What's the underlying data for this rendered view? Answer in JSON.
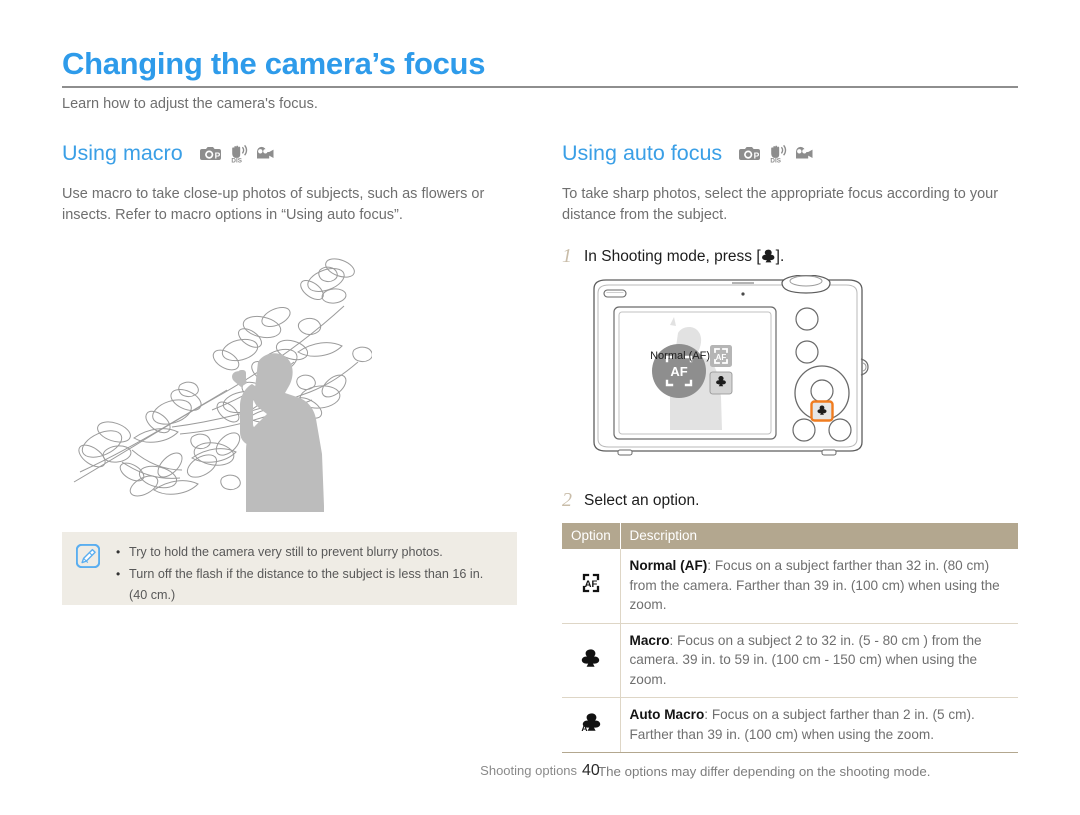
{
  "header": {
    "title": "Changing the camera’s focus",
    "subtitle": "Learn how to adjust the camera's focus.",
    "accent_color": "#2e9bea",
    "rule_color": "#8e8e8e"
  },
  "left_section": {
    "heading": "Using macro",
    "mode_icons": [
      "program-camera-icon",
      "dis-hand-icon",
      "movie-camera-icon"
    ],
    "body": "Use macro to take close-up photos of subjects, such as flowers or insects. Refer to macro options in “Using auto focus”.",
    "illustration": "magnolia-branch-photographer-illustration"
  },
  "right_section": {
    "heading": "Using auto focus",
    "mode_icons": [
      "program-camera-icon",
      "dis-hand-icon",
      "movie-camera-icon"
    ],
    "body": "To take sharp photos, select the appropriate focus according to your distance from the subject.",
    "steps": [
      {
        "num": "1",
        "text_before": "In Shooting mode, press [",
        "icon": "macro-flower-icon",
        "text_after": "]."
      },
      {
        "num": "2",
        "text_before": "Select an option.",
        "icon": "",
        "text_after": ""
      }
    ],
    "camera": {
      "name": "compact-digital-camera-back-illustration",
      "lcd_label": "Normal (AF)",
      "osd_icons": [
        "af-bracket-icon",
        "macro-flower-icon"
      ],
      "highlight_color": "#f07c1f",
      "highlighted_button": "macro-button"
    },
    "table": {
      "headers": [
        "Option",
        "Description"
      ],
      "header_bg": "#b3a78f",
      "rows": [
        {
          "icon": "af-bracket-icon",
          "term": "Normal (AF)",
          "desc": ": Focus on a subject farther than 32 in. (80 cm) from the camera. Farther than 39 in. (100 cm) when using the zoom."
        },
        {
          "icon": "macro-flower-icon",
          "term": "Macro",
          "desc": ": Focus on a subject 2 to 32 in. (5 - 80 cm ) from the camera. 39 in. to 59 in. (100 cm - 150 cm) when using the zoom."
        },
        {
          "icon": "auto-macro-flower-icon",
          "term": "Auto Macro",
          "desc": ": Focus on a subject farther than 2 in. (5 cm). Farther than 39 in. (100 cm) when using the zoom."
        }
      ],
      "note": "The options may differ depending on the shooting mode."
    }
  },
  "tip_box": {
    "icon": "note-pen-icon",
    "bg": "#efece5",
    "items": [
      "Try to hold the camera very still to prevent blurry photos.",
      "Turn off the flash if the distance to the subject is less than 16 in."
    ],
    "continuation": "(40 cm.)"
  },
  "footer": {
    "label": "Shooting options",
    "page_number": "40"
  }
}
